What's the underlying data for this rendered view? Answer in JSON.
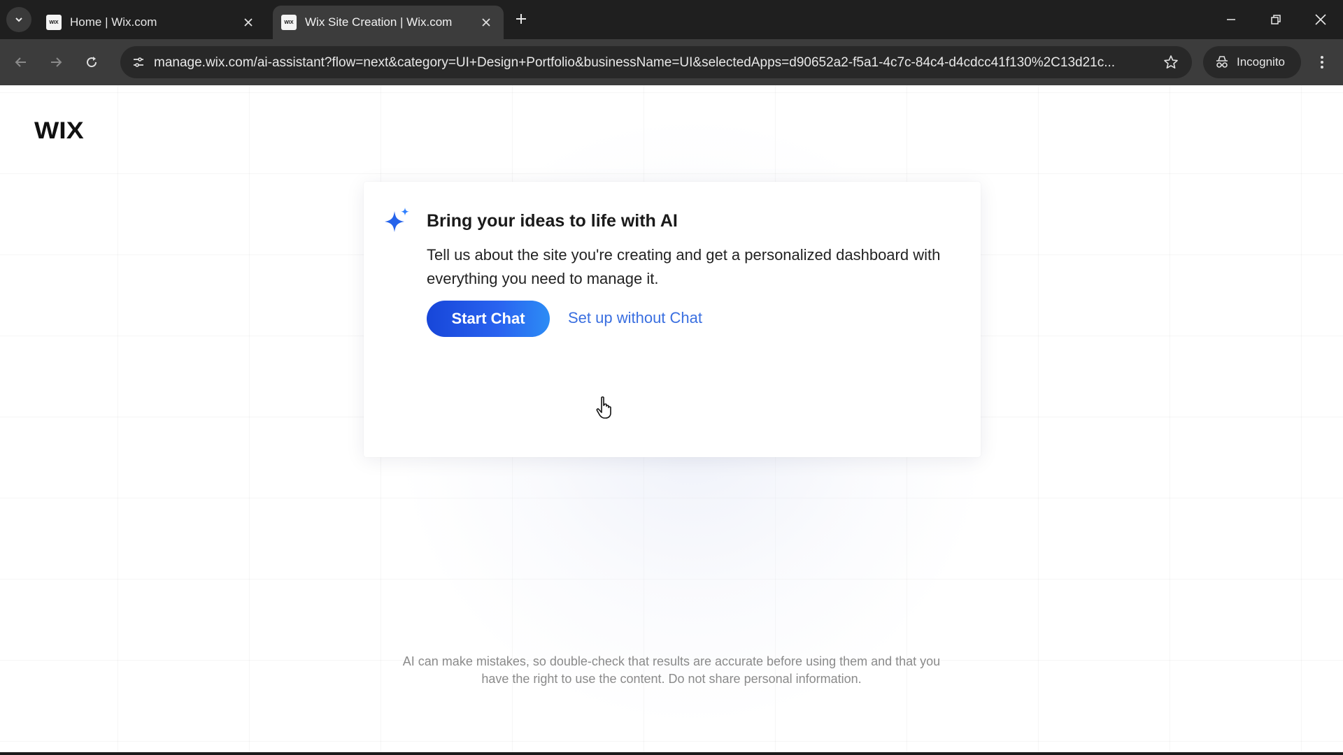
{
  "browser": {
    "tabs": [
      {
        "title": "Home | Wix.com",
        "favicon": "WIX",
        "active": false
      },
      {
        "title": "Wix Site Creation | Wix.com",
        "favicon": "WIX",
        "active": true
      }
    ],
    "url": "manage.wix.com/ai-assistant?flow=next&category=UI+Design+Portfolio&businessName=UI&selectedApps=d90652a2-f5a1-4c7c-84c4-d4cdcc41f130%2C13d21c...",
    "incognito_label": "Incognito",
    "icons": {
      "tab_search": "chevron-down-icon",
      "new_tab": "plus-icon",
      "back": "arrow-left-icon",
      "forward": "arrow-right-icon",
      "reload": "reload-icon",
      "site_info": "tune-icon",
      "bookmark": "star-icon",
      "incognito": "incognito-icon",
      "menu": "kebab-menu-icon"
    }
  },
  "page": {
    "logo": "WIX",
    "card": {
      "title": "Bring your ideas to life with AI",
      "description": "Tell us about the site you're creating and get a personalized dashboard with everything you need to manage it.",
      "primary_button": "Start Chat",
      "secondary_link": "Set up without Chat"
    },
    "disclaimer_line1": "AI can make mistakes, so double-check that results are accurate before using them and that you",
    "disclaimer_line2": "have the right to use the content. Do not share personal information."
  },
  "colors": {
    "chrome_dark": "#1f1f1f",
    "toolbar": "#3c3c3c",
    "primary_button_start": "#1746d9",
    "primary_button_end": "#2c8cf5",
    "link": "#3a6fe0",
    "sparkle": "#2563eb"
  }
}
